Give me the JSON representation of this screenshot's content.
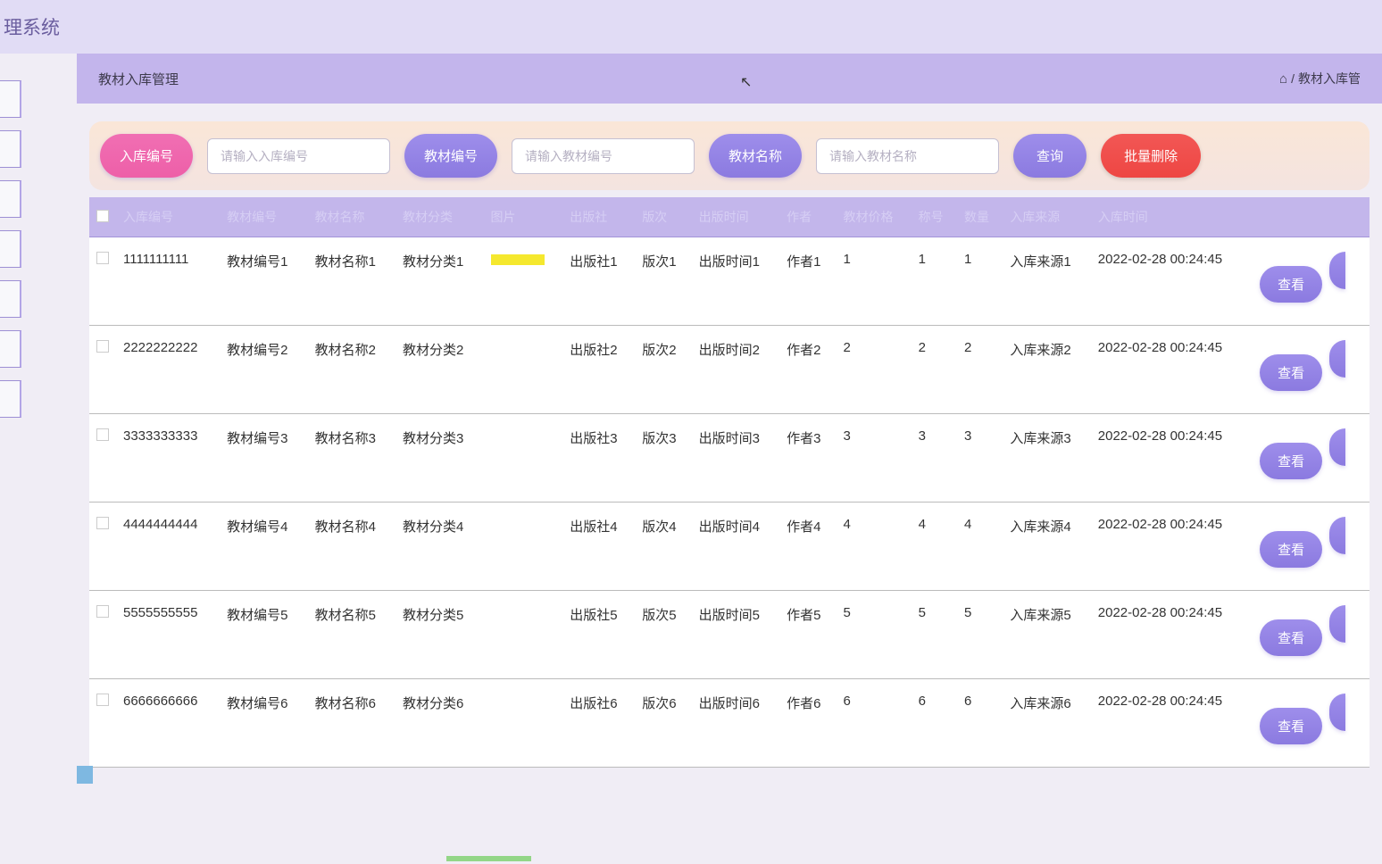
{
  "header": {
    "title": "理系统"
  },
  "page": {
    "title": "教材入库管理",
    "breadcrumb_current": "教材入库管"
  },
  "search": {
    "label_inbound_id": "入库编号",
    "placeholder_inbound_id": "请输入入库编号",
    "label_textbook_id": "教材编号",
    "placeholder_textbook_id": "请输入教材编号",
    "label_textbook_name": "教材名称",
    "placeholder_textbook_name": "请输入教材名称",
    "btn_query": "查询",
    "btn_batch_delete": "批量删除"
  },
  "table": {
    "headers": {
      "h1": "入库编号",
      "h2": "教材编号",
      "h3": "教材名称",
      "h4": "教材分类",
      "h5": "图片",
      "h6": "出版社",
      "h7": "版次",
      "h8": "出版时间",
      "h9": "作者",
      "h10": "教材价格",
      "h11": "称号",
      "h12": "数量",
      "h13": "入库来源",
      "h14": "入库时间"
    },
    "rows": [
      {
        "inbound_id": "1111111111",
        "textbook_id": "教材编号1",
        "textbook_name": "教材名称1",
        "category": "教材分类1",
        "image": "yellow",
        "publisher": "出版社1",
        "edition": "版次1",
        "pub_time": "出版时间1",
        "author": "作者1",
        "c1": "1",
        "c2": "1",
        "c3": "1",
        "source": "入库来源1",
        "time": "2022-02-28 00:24:45"
      },
      {
        "inbound_id": "2222222222",
        "textbook_id": "教材编号2",
        "textbook_name": "教材名称2",
        "category": "教材分类2",
        "image": "",
        "publisher": "出版社2",
        "edition": "版次2",
        "pub_time": "出版时间2",
        "author": "作者2",
        "c1": "2",
        "c2": "2",
        "c3": "2",
        "source": "入库来源2",
        "time": "2022-02-28 00:24:45"
      },
      {
        "inbound_id": "3333333333",
        "textbook_id": "教材编号3",
        "textbook_name": "教材名称3",
        "category": "教材分类3",
        "image": "",
        "publisher": "出版社3",
        "edition": "版次3",
        "pub_time": "出版时间3",
        "author": "作者3",
        "c1": "3",
        "c2": "3",
        "c3": "3",
        "source": "入库来源3",
        "time": "2022-02-28 00:24:45"
      },
      {
        "inbound_id": "4444444444",
        "textbook_id": "教材编号4",
        "textbook_name": "教材名称4",
        "category": "教材分类4",
        "image": "",
        "publisher": "出版社4",
        "edition": "版次4",
        "pub_time": "出版时间4",
        "author": "作者4",
        "c1": "4",
        "c2": "4",
        "c3": "4",
        "source": "入库来源4",
        "time": "2022-02-28 00:24:45"
      },
      {
        "inbound_id": "5555555555",
        "textbook_id": "教材编号5",
        "textbook_name": "教材名称5",
        "category": "教材分类5",
        "image": "",
        "publisher": "出版社5",
        "edition": "版次5",
        "pub_time": "出版时间5",
        "author": "作者5",
        "c1": "5",
        "c2": "5",
        "c3": "5",
        "source": "入库来源5",
        "time": "2022-02-28 00:24:45"
      },
      {
        "inbound_id": "6666666666",
        "textbook_id": "教材编号6",
        "textbook_name": "教材名称6",
        "category": "教材分类6",
        "image": "",
        "publisher": "出版社6",
        "edition": "版次6",
        "pub_time": "出版时间6",
        "author": "作者6",
        "c1": "6",
        "c2": "6",
        "c3": "6",
        "source": "入库来源6",
        "time": "2022-02-28 00:24:45"
      }
    ],
    "action_view": "查看"
  }
}
